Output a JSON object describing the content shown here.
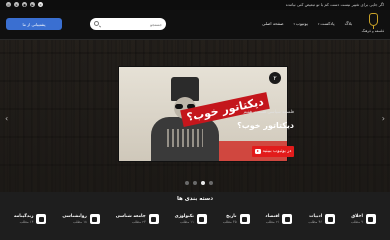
{
  "topbar": {
    "notice": "اگر جایی برای تغییر نیست دست کم با تو تبعیض کنی نیامده",
    "socials": [
      "instagram-icon",
      "telegram-icon",
      "twitter-icon",
      "youtube-icon",
      "x-icon"
    ]
  },
  "header": {
    "logo_text": "فلسفه و فرهنگ",
    "nav": [
      {
        "label": "صفحه اصلی",
        "dropdown": false
      },
      {
        "label": "یوتیوب",
        "dropdown": true
      },
      {
        "label": "پادکست",
        "dropdown": true
      },
      {
        "label": "بلاگ",
        "dropdown": false
      }
    ],
    "search_placeholder": "جستجو",
    "support_label": "پشتیبانی از ما"
  },
  "hero": {
    "badge": "۲",
    "thumb_title": "دیکتاتور خوب؟",
    "category": "فلسفه سیاسی قسمت هفتم",
    "title": "دیکتاتور خوب؟",
    "youtube_label": "در یوتیوب ببینید",
    "dots_count": 4,
    "active_dot": 3
  },
  "categories": {
    "title": "دسته بندی ها",
    "items": [
      {
        "name": "اخلاق",
        "count": "۹ مطلب"
      },
      {
        "name": "ادبیات",
        "count": "۴۶ مطلب"
      },
      {
        "name": "اقتصاد",
        "count": "۲۱ مطلب"
      },
      {
        "name": "تاریخ",
        "count": "۳۵ مطلب"
      },
      {
        "name": "تکنولوژی",
        "count": "۱۱ مطلب"
      },
      {
        "name": "جامعه شناسی",
        "count": "۲۳ مطلب"
      },
      {
        "name": "روانشناسی",
        "count": "۱۸ مطلب"
      },
      {
        "name": "زندگینامه",
        "count": "۱۴ مطلب"
      }
    ]
  }
}
